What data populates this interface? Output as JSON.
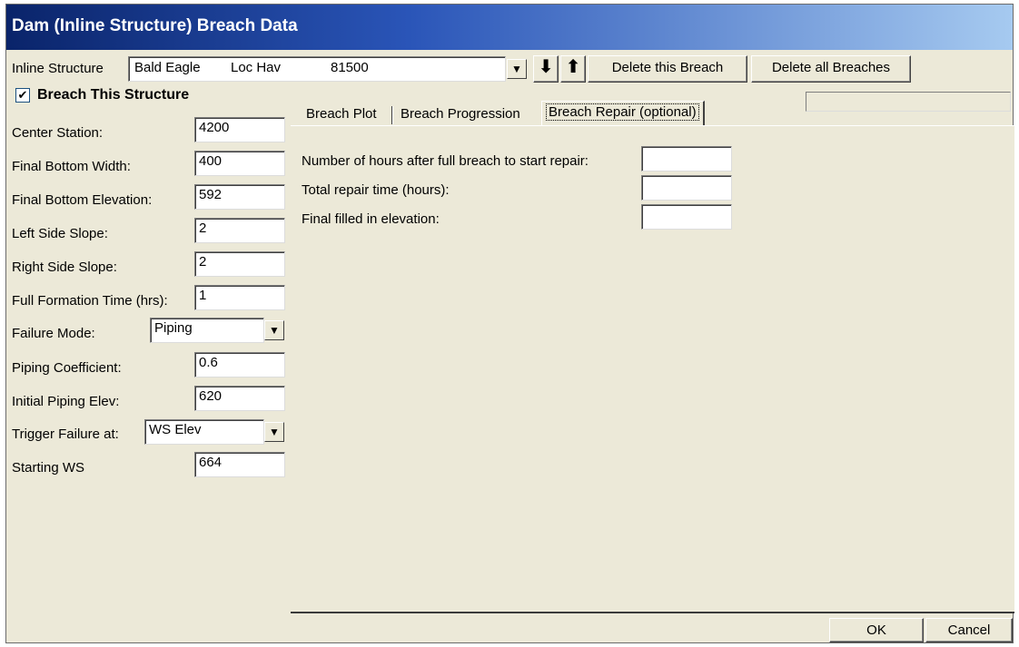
{
  "window": {
    "title": "Dam (Inline Structure) Breach Data"
  },
  "toolbar": {
    "inline_structure_label": "Inline Structure",
    "structure_river": "Bald Eagle",
    "structure_reach": "Loc Hav",
    "structure_station": "81500",
    "down_arrow": "⬇",
    "up_arrow": "⬆",
    "delete_breach_label": "Delete this Breach",
    "delete_all_label": "Delete all Breaches"
  },
  "breach": {
    "checkbox_label": "Breach This Structure",
    "checked_mark": "✔",
    "dropdown_arrow": "▼",
    "fields": [
      {
        "label": "Center Station:",
        "value": "4200"
      },
      {
        "label": "Final Bottom Width:",
        "value": "400"
      },
      {
        "label": "Final Bottom Elevation:",
        "value": "592"
      },
      {
        "label": "Left Side Slope:",
        "value": "2"
      },
      {
        "label": "Right Side Slope:",
        "value": "2"
      },
      {
        "label": "Full Formation Time (hrs):",
        "value": "1"
      }
    ],
    "failure_mode": {
      "label": "Failure Mode:",
      "value": "Piping"
    },
    "fields2": [
      {
        "label": "Piping Coefficient:",
        "value": "0.6"
      },
      {
        "label": "Initial Piping Elev:",
        "value": "620"
      }
    ],
    "trigger": {
      "label": "Trigger Failure at:",
      "value": "WS Elev"
    },
    "starting_ws": {
      "label": "Starting WS",
      "value": "664"
    }
  },
  "tabs": [
    {
      "label": "Breach Plot"
    },
    {
      "label": "Breach Progression"
    },
    {
      "label": "Breach Repair (optional)"
    }
  ],
  "repair": {
    "hours_label": "Number of hours after full breach to start repair:",
    "hours_value": "",
    "total_label": "Total repair time  (hours):",
    "total_value": "",
    "filled_label": "Final filled in elevation:",
    "filled_value": ""
  },
  "footer": {
    "ok_label": "OK",
    "cancel_label": "Cancel"
  }
}
